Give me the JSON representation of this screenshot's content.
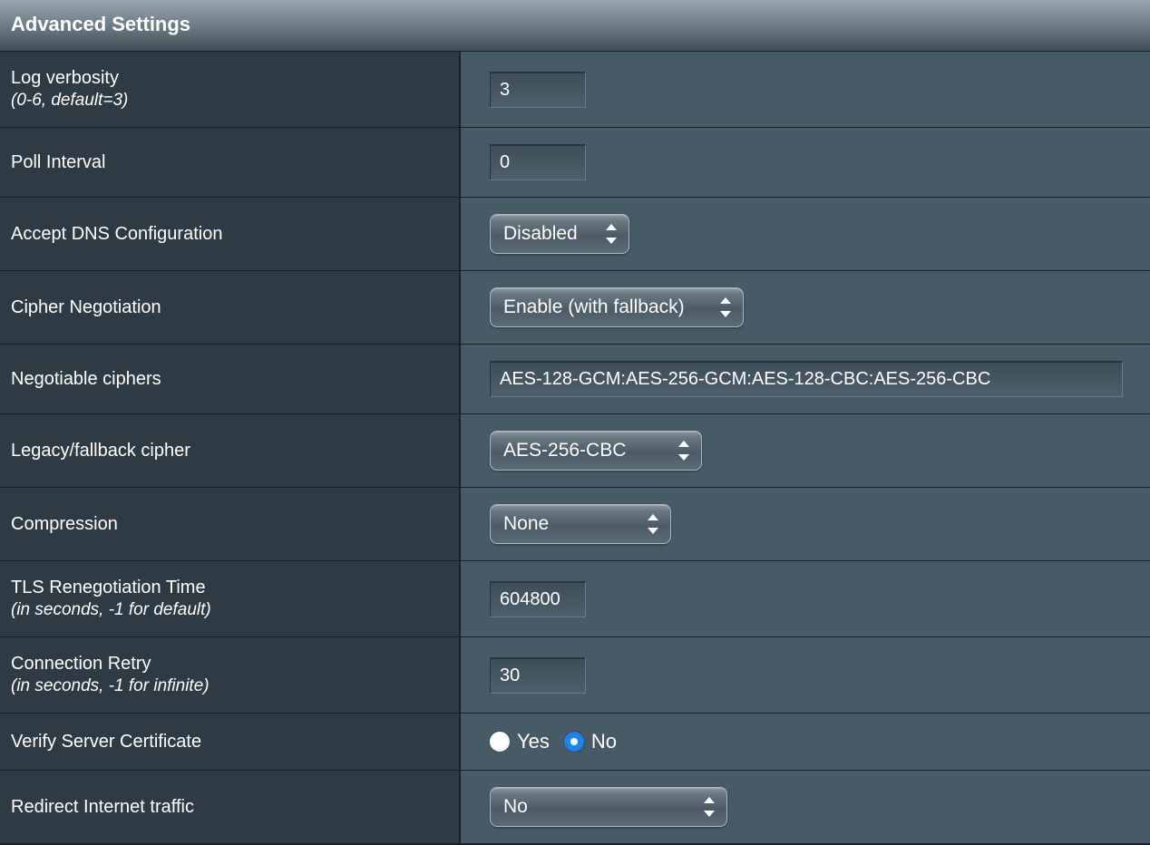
{
  "header": {
    "title": "Advanced Settings"
  },
  "rows": {
    "logVerbosity": {
      "label": "Log verbosity",
      "sub": "(0-6, default=3)",
      "value": "3"
    },
    "pollInterval": {
      "label": "Poll Interval",
      "value": "0"
    },
    "acceptDns": {
      "label": "Accept DNS Configuration",
      "value": "Disabled"
    },
    "cipherNegotiation": {
      "label": "Cipher Negotiation",
      "value": "Enable (with fallback)"
    },
    "negotiableCiphers": {
      "label": "Negotiable ciphers",
      "value": "AES-128-GCM:AES-256-GCM:AES-128-CBC:AES-256-CBC"
    },
    "fallbackCipher": {
      "label": "Legacy/fallback cipher",
      "value": "AES-256-CBC"
    },
    "compression": {
      "label": "Compression",
      "value": "None"
    },
    "tlsReneg": {
      "label": "TLS Renegotiation Time",
      "sub": "(in seconds, -1 for default)",
      "value": "604800"
    },
    "connectionRetry": {
      "label": "Connection Retry",
      "sub": "(in seconds, -1 for infinite)",
      "value": "30"
    },
    "verifyCert": {
      "label": "Verify Server Certificate",
      "yes": "Yes",
      "no": "No",
      "selected": "No"
    },
    "redirectTraffic": {
      "label": "Redirect Internet traffic",
      "value": "No"
    }
  }
}
